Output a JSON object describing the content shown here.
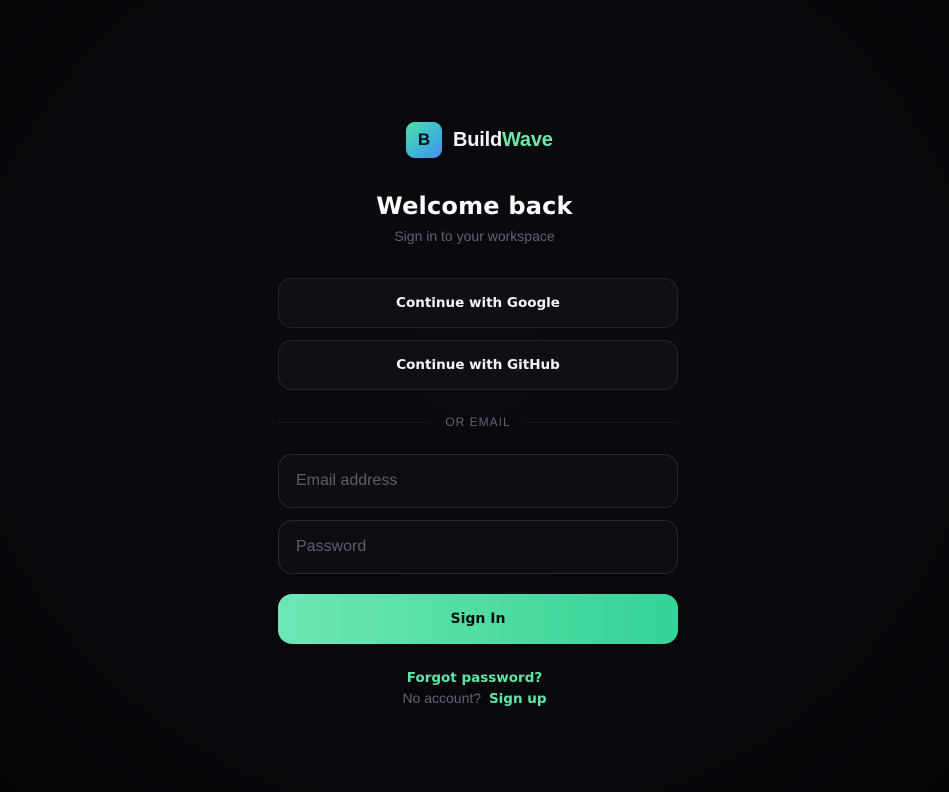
{
  "brand": {
    "logo_letter": "B",
    "name_part1": "Build",
    "name_part2": "Wave",
    "accent_color": "#6ee7a8"
  },
  "header": {
    "title": "Welcome back",
    "subtitle": "Sign in to your workspace"
  },
  "oauth": {
    "google_label": "Continue with Google",
    "github_label": "Continue with GitHub"
  },
  "divider": {
    "label": "OR EMAIL"
  },
  "form": {
    "email_value": "",
    "email_placeholder": "Email address",
    "password_value": "",
    "password_placeholder": "Password",
    "submit_label": "Sign In"
  },
  "footer": {
    "forgot_label": "Forgot password?",
    "signup_prompt": "No account?",
    "signup_label": "Sign up"
  },
  "colors": {
    "background": "#08080c",
    "button_gradient_start": "#6ee7b7",
    "button_gradient_end": "#34d399",
    "link": "#5ee6a5"
  }
}
